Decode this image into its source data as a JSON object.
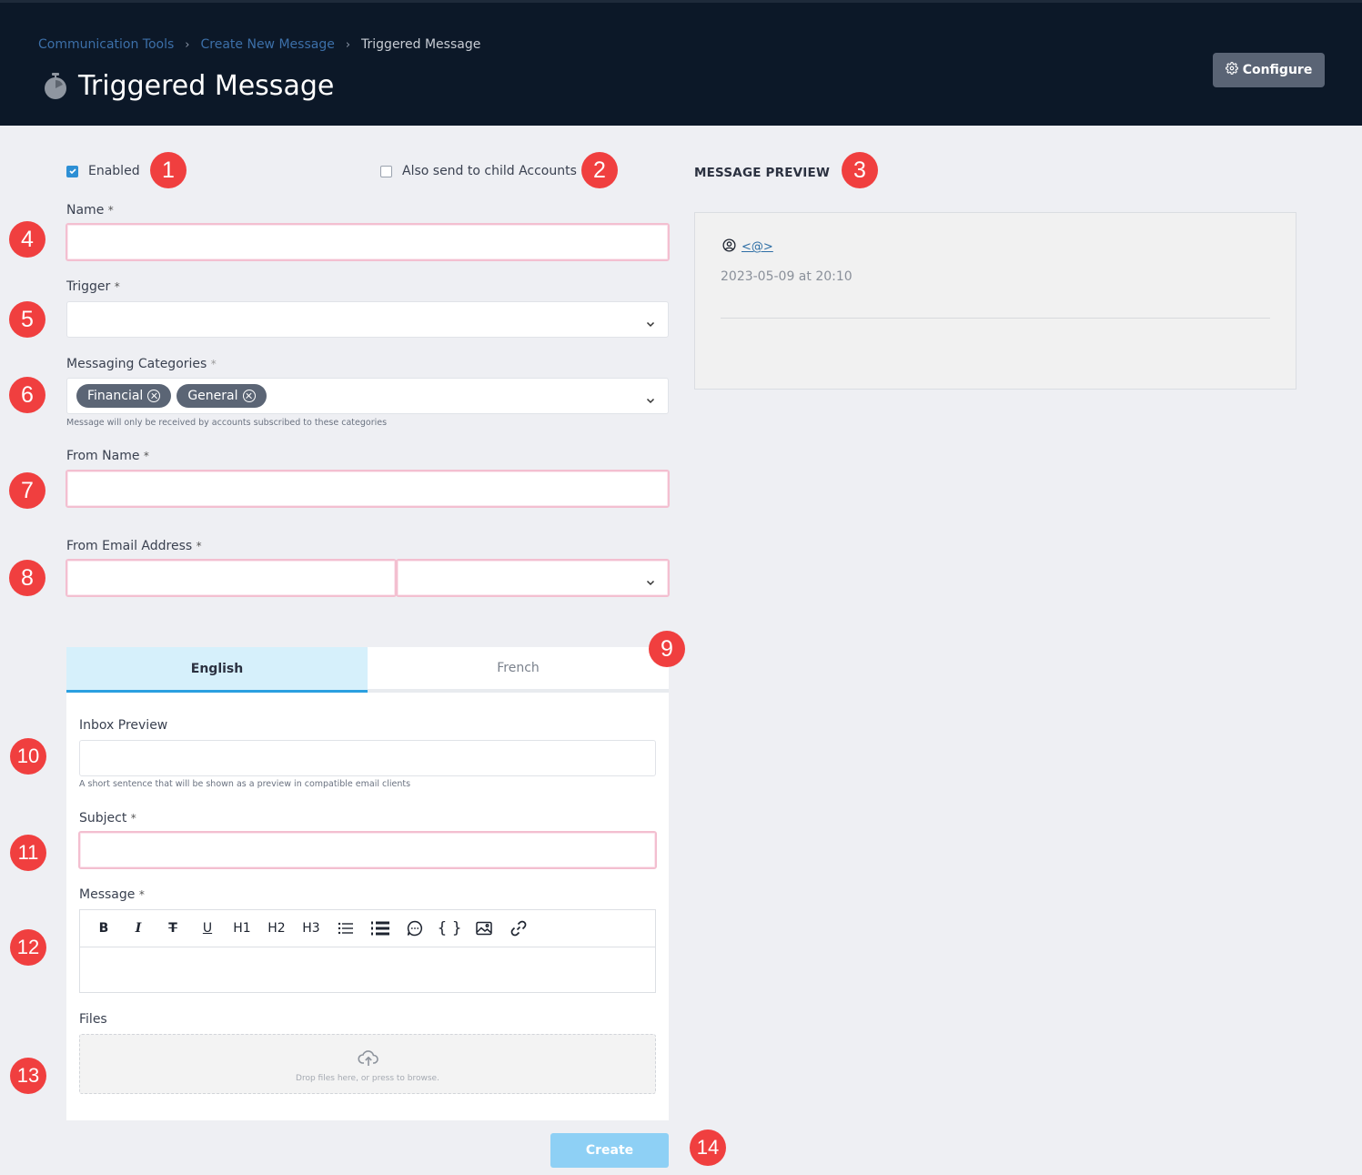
{
  "header": {
    "breadcrumb": [
      "Communication Tools",
      "Create New Message",
      "Triggered Message"
    ],
    "title": "Triggered Message",
    "configure_label": "Configure"
  },
  "form": {
    "enabled_label": "Enabled",
    "enabled_checked": true,
    "child_accounts_label": "Also send to child Accounts",
    "child_accounts_checked": false,
    "name_label": "Name",
    "name_value": "",
    "trigger_label": "Trigger",
    "trigger_value": "",
    "categories_label": "Messaging Categories",
    "categories": [
      "Financial",
      "General"
    ],
    "categories_help": "Message will only be received by accounts subscribed to these categories",
    "from_name_label": "From Name",
    "from_name_value": "",
    "from_email_label": "From Email Address",
    "from_email_local": "",
    "from_email_domain": "",
    "required_marker": "*"
  },
  "preview": {
    "title": "MESSAGE PREVIEW",
    "sender": "<@>",
    "date": "2023-05-09 at 20:10"
  },
  "tabs": [
    {
      "label": "English",
      "active": true
    },
    {
      "label": "French",
      "active": false
    }
  ],
  "content": {
    "inbox_preview_label": "Inbox Preview",
    "inbox_preview_value": "",
    "inbox_preview_help": "A short sentence that will be shown as a preview in compatible email clients",
    "subject_label": "Subject",
    "subject_value": "",
    "message_label": "Message",
    "toolbar": [
      "B",
      "I",
      "T",
      "U",
      "H1",
      "H2",
      "H3",
      "bullet-list-icon",
      "numbered-list-icon",
      "comment-icon",
      "code-braces-icon",
      "image-icon",
      "link-icon"
    ],
    "files_label": "Files",
    "dropzone_text": "Drop files here, or press to browse."
  },
  "create_label": "Create",
  "annotations": [
    "1",
    "2",
    "3",
    "4",
    "5",
    "6",
    "7",
    "8",
    "9",
    "10",
    "11",
    "12",
    "13",
    "14"
  ],
  "colors": {
    "header_bg": "#0c1828",
    "badge": "#f03f3f",
    "accent": "#2a9fe0",
    "error_border": "#f3bfd0",
    "create_button": "#8ed0f5"
  }
}
